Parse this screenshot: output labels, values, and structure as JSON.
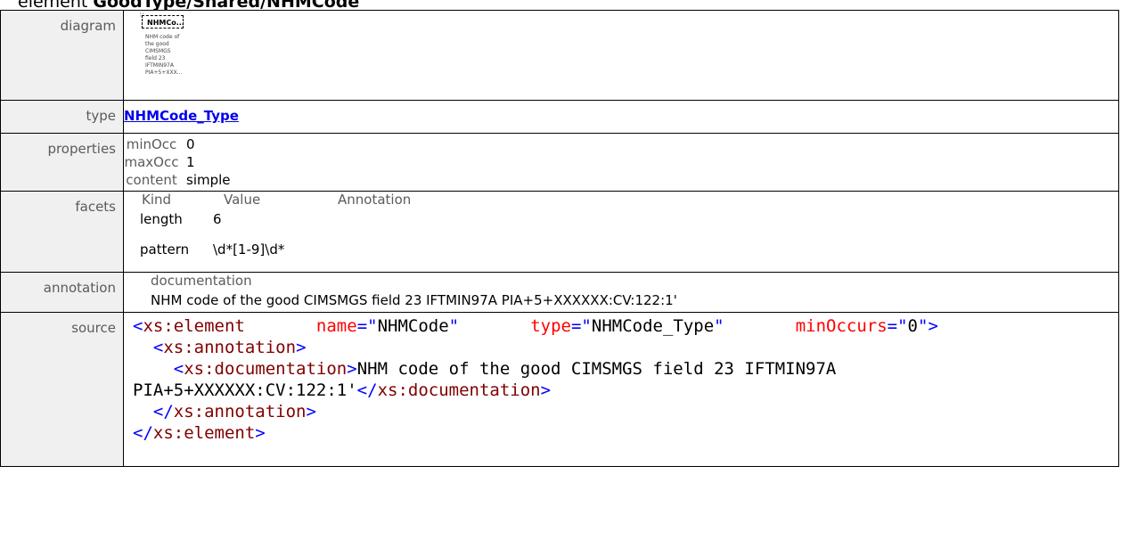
{
  "header": {
    "prefix": "element ",
    "path": "GoodType/Shared/NHMCode"
  },
  "rows": {
    "diagram": {
      "label": "diagram",
      "box_label": "NHMCo...",
      "box_mark": "∷",
      "doc_lines": [
        "NHM code of",
        "the good",
        "CIMSMGS",
        "field 23",
        "IFTMIN97A",
        "PIA+5+XXX..."
      ]
    },
    "type": {
      "label": "type",
      "link": "NHMCode_Type"
    },
    "properties": {
      "label": "properties",
      "items": [
        {
          "key": "minOcc",
          "value": "0"
        },
        {
          "key": "maxOcc",
          "value": "1"
        },
        {
          "key": "content",
          "value": "simple"
        }
      ]
    },
    "facets": {
      "label": "facets",
      "headers": {
        "kind": "Kind",
        "value": "Value",
        "annotation": "Annotation"
      },
      "items": [
        {
          "kind": "length",
          "value": "6"
        },
        {
          "kind": "pattern",
          "value": "\\d*[1-9]\\d*"
        }
      ]
    },
    "annotation": {
      "label": "annotation",
      "key": "documentation",
      "text": "NHM code of the good CIMSMGS field 23 IFTMIN97A PIA+5+XXXXXX:CV:122:1'"
    },
    "source": {
      "label": "source",
      "el_open": "xs:element",
      "attr_name": "name",
      "attr_name_val": "NHMCode",
      "attr_type": "type",
      "attr_type_val": "NHMCode_Type",
      "attr_min": "minOccurs",
      "attr_min_val": "0",
      "ann_tag": "xs:annotation",
      "doc_tag": "xs:documentation",
      "doc_text_1": "NHM code of the good CIMSMGS field 23 IFTMIN97A",
      "doc_text_2": "PIA+5+XXXXXX:CV:122:1'"
    }
  }
}
